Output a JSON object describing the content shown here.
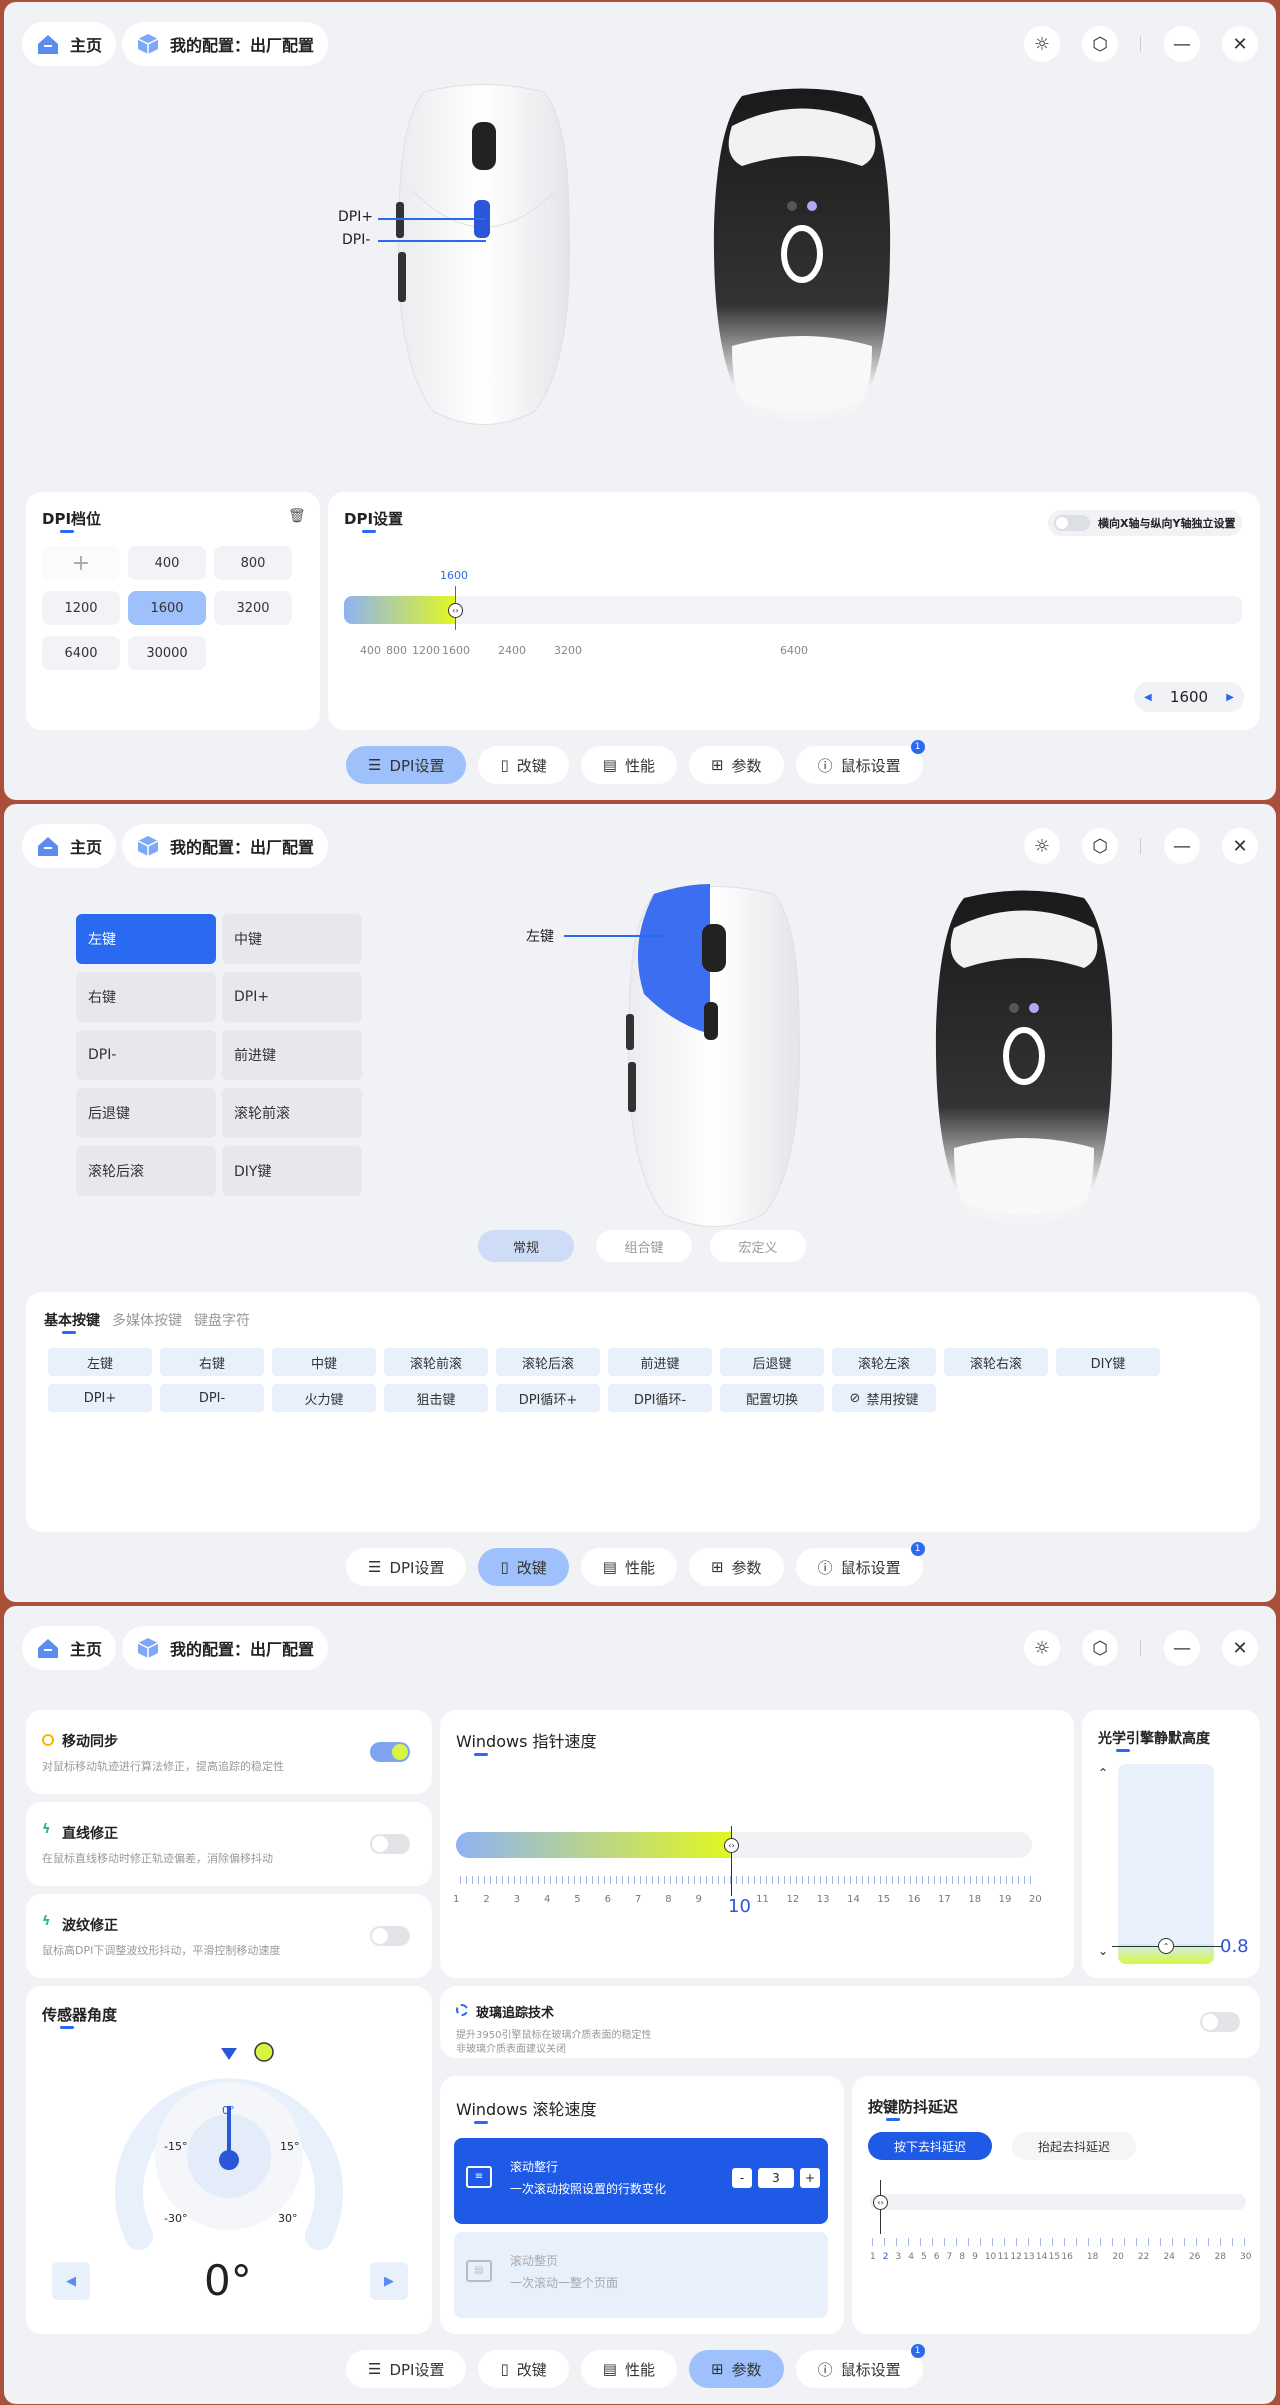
{
  "header": {
    "home": "主页",
    "config": "我的配置：出厂配置"
  },
  "nav": {
    "dpi": "DPI设置",
    "remap": "改键",
    "perf": "性能",
    "params": "参数",
    "mouse": "鼠标设置",
    "badge": "1"
  },
  "p1": {
    "dpi_level_title": "DPI档位",
    "dpi_levels": [
      "400",
      "800",
      "1200",
      "1600",
      "3200",
      "6400",
      "30000"
    ],
    "dpi_set_title": "DPI设置",
    "xy_toggle": "横向X轴与纵向Y轴独立设置",
    "current": "1600",
    "slider_marks": [
      "400",
      "800",
      "1200",
      "1600",
      "2400",
      "3200",
      "6400"
    ],
    "stepper_value": "1600",
    "callout_plus": "DPI+",
    "callout_minus": "DPI-"
  },
  "p2": {
    "keys": [
      "左键",
      "中键",
      "右键",
      "DPI+",
      "DPI-",
      "前进键",
      "后退键",
      "滚轮前滚",
      "滚轮后滚",
      "DIY键"
    ],
    "callout": "左键",
    "modes": [
      "常规",
      "组合键",
      "宏定义"
    ],
    "func_tabs": [
      "基本按键",
      "多媒体按键",
      "键盘字符"
    ],
    "func_row1": [
      "左键",
      "右键",
      "中键",
      "滚轮前滚",
      "滚轮后滚",
      "前进键",
      "后退键",
      "滚轮左滚",
      "滚轮右滚",
      "DIY键"
    ],
    "func_row2": [
      "DPI+",
      "DPI-",
      "火力键",
      "狙击键",
      "DPI循环+",
      "DPI循环-",
      "配置切换",
      "禁用按键"
    ]
  },
  "p3": {
    "motion_sync": {
      "title": "移动同步",
      "desc": "对鼠标移动轨迹进行算法修正，提高追踪的稳定性"
    },
    "angle_snap": {
      "title": "直线修正",
      "desc": "在鼠标直线移动时修正轨迹偏差，消除偏移抖动"
    },
    "ripple": {
      "title": "波纹修正",
      "desc": "鼠标高DPI下调整波纹形抖动，平滑控制移动速度"
    },
    "win_speed": {
      "title": "Windows 指针速度",
      "value": "10",
      "ticks": [
        "1",
        "2",
        "3",
        "4",
        "5",
        "6",
        "7",
        "8",
        "9",
        "10",
        "11",
        "12",
        "13",
        "14",
        "15",
        "16",
        "17",
        "18",
        "19",
        "20"
      ]
    },
    "lod": {
      "title": "光学引擎静默高度",
      "value": "0.8"
    },
    "sensor": {
      "title": "传感器角度",
      "value": "0°",
      "ticks": [
        "0°",
        "-15°",
        "15°",
        "-30°",
        "30°"
      ]
    },
    "glass": {
      "title": "玻璃追踪技术",
      "desc1": "提升3950引擎鼠标在玻璃介质表面的稳定性",
      "desc2": "非玻璃介质表面建议关闭"
    },
    "scroll": {
      "title": "Windows 滚轮速度",
      "line_title": "滚动整行",
      "line_desc": "一次滚动按照设置的行数变化",
      "lines": "3",
      "page_title": "滚动整页",
      "page_desc": "一次滚动一整个页面"
    },
    "debounce": {
      "title": "按键防抖延迟",
      "press": "按下去抖延迟",
      "release": "抬起去抖延迟",
      "ticks": [
        "1",
        "2",
        "3",
        "4",
        "5",
        "6",
        "7",
        "8",
        "9",
        "10",
        "11",
        "12",
        "13",
        "14",
        "15",
        "16",
        "18",
        "20",
        "22",
        "24",
        "26",
        "28",
        "30"
      ]
    }
  }
}
